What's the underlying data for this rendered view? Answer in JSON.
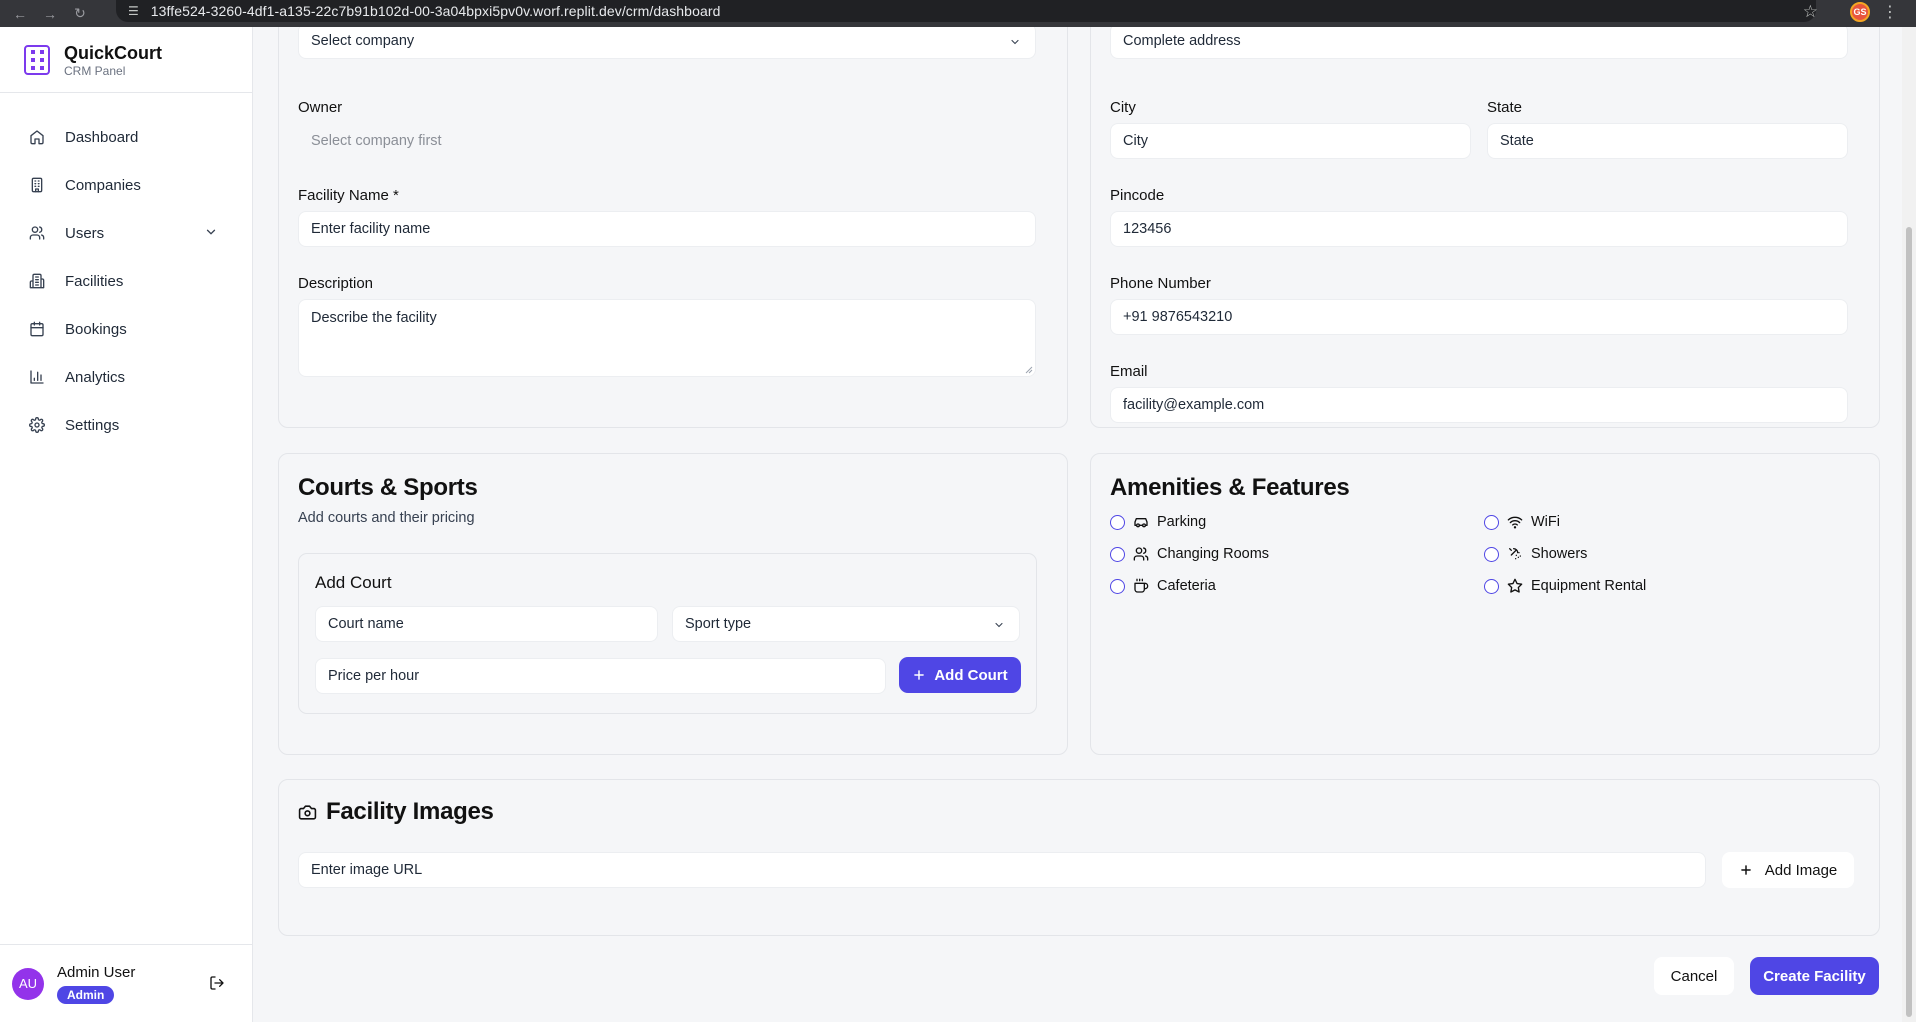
{
  "browser": {
    "url": "13ffe524-3260-4df1-a135-22c7b91b102d-00-3a04bpxi5pv0v.worf.replit.dev/crm/dashboard",
    "profile_initials": "GS"
  },
  "sidebar": {
    "brand": {
      "title": "QuickCourt",
      "subtitle": "CRM Panel"
    },
    "items": [
      {
        "label": "Dashboard",
        "icon": "home-icon"
      },
      {
        "label": "Companies",
        "icon": "building-icon"
      },
      {
        "label": "Users",
        "icon": "users-icon"
      },
      {
        "label": "Facilities",
        "icon": "building-icon"
      },
      {
        "label": "Bookings",
        "icon": "calendar-icon"
      },
      {
        "label": "Analytics",
        "icon": "bar-chart-icon"
      },
      {
        "label": "Settings",
        "icon": "gear-icon"
      }
    ],
    "user": {
      "initials": "AU",
      "name": "Admin User",
      "role": "Admin"
    }
  },
  "form": {
    "company": {
      "placeholder": "Select company"
    },
    "owner": {
      "label": "Owner",
      "placeholder": "Select company first"
    },
    "facility_name": {
      "label": "Facility Name *",
      "placeholder": "Enter facility name"
    },
    "description": {
      "label": "Description",
      "placeholder": "Describe the facility"
    },
    "address": {
      "placeholder": "Complete address"
    },
    "city": {
      "label": "City",
      "placeholder": "City"
    },
    "state": {
      "label": "State",
      "placeholder": "State"
    },
    "pincode": {
      "label": "Pincode",
      "placeholder": "123456"
    },
    "phone": {
      "label": "Phone Number",
      "placeholder": "+91 9876543210"
    },
    "email": {
      "label": "Email",
      "placeholder": "facility@example.com"
    }
  },
  "courts": {
    "title": "Courts & Sports",
    "subtitle": "Add courts and their pricing",
    "add_court_title": "Add Court",
    "court_name_placeholder": "Court name",
    "sport_type_placeholder": "Sport type",
    "price_placeholder": "Price per hour",
    "add_button": "Add Court"
  },
  "amenities": {
    "title": "Amenities & Features",
    "items": [
      {
        "label": "Parking",
        "icon": "car-icon",
        "checked": false
      },
      {
        "label": "WiFi",
        "icon": "wifi-icon",
        "checked": false
      },
      {
        "label": "Changing Rooms",
        "icon": "users-icon",
        "checked": false
      },
      {
        "label": "Showers",
        "icon": "shower-icon",
        "checked": false
      },
      {
        "label": "Cafeteria",
        "icon": "coffee-icon",
        "checked": false
      },
      {
        "label": "Equipment Rental",
        "icon": "star-icon",
        "checked": false
      }
    ]
  },
  "images": {
    "title": "Facility Images",
    "url_placeholder": "Enter image URL",
    "add_button": "Add Image"
  },
  "footer": {
    "cancel": "Cancel",
    "create": "Create Facility"
  }
}
